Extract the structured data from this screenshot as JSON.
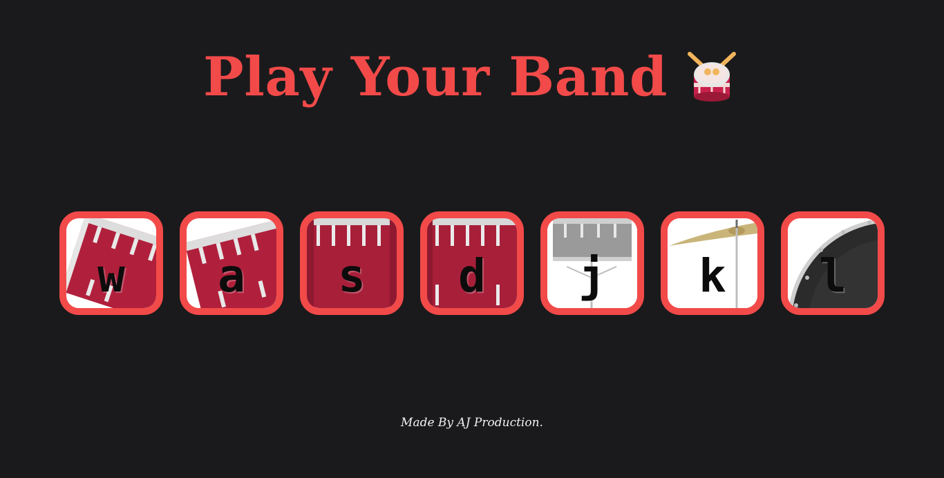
{
  "header": {
    "title": "Play Your Band",
    "icon": "drum-icon"
  },
  "pads": [
    {
      "key": "w",
      "instrument": "tom-drum-icon",
      "color": "#b0203c"
    },
    {
      "key": "a",
      "instrument": "tom-drum-icon",
      "color": "#b0203c"
    },
    {
      "key": "s",
      "instrument": "tom-drum-icon",
      "color": "#a81f3a"
    },
    {
      "key": "d",
      "instrument": "tom-drum-icon",
      "color": "#a81f3a"
    },
    {
      "key": "j",
      "instrument": "snare-drum-icon",
      "color": "#9a9a9a"
    },
    {
      "key": "k",
      "instrument": "cymbal-icon",
      "color": "#c9b47a"
    },
    {
      "key": "l",
      "instrument": "bass-drum-icon",
      "color": "#2b2b2b"
    }
  ],
  "footer": {
    "text": "Made By AJ Production."
  },
  "colors": {
    "background": "#1a1a1c",
    "accent": "#f24a49"
  }
}
